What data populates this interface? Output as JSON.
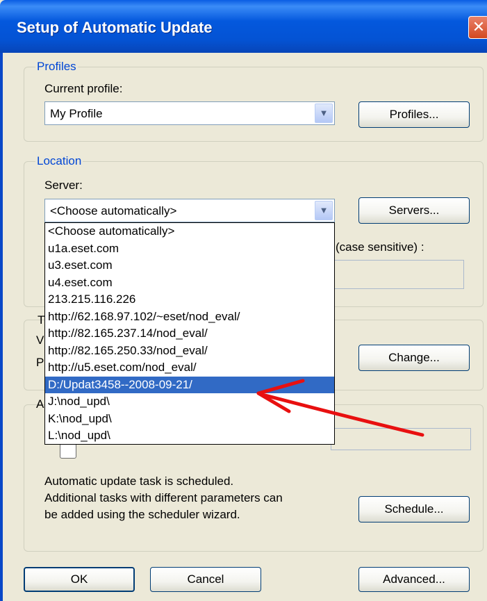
{
  "window": {
    "title": "Setup of Automatic Update",
    "close_glyph": "✕"
  },
  "profiles": {
    "legend": "Profiles",
    "current_label": "Current profile:",
    "current_value": "My Profile",
    "button": "Profiles..."
  },
  "location": {
    "legend": "Location",
    "server_label": "Server:",
    "server_value": "<Choose automatically>",
    "button": "Servers...",
    "hidden_label_tail": "(case sensitive) :"
  },
  "dropdown": {
    "items": [
      "<Choose automatically>",
      "u1a.eset.com",
      "u3.eset.com",
      "u4.eset.com",
      "213.215.116.226",
      "http://62.168.97.102/~eset/nod_eval/",
      "http://82.165.237.14/nod_eval/",
      "http://82.165.250.33/nod_eval/",
      "http://u5.eset.com/nod_eval/",
      "D:/Updat3458--2008-09-21/",
      "J:\\nod_upd\\",
      "K:\\nod_upd\\",
      "L:\\nod_upd\\"
    ],
    "selected_index": 9
  },
  "partial_letters": {
    "t": "T",
    "v": "V",
    "p": "P",
    "a": "A"
  },
  "type_group": {
    "button": "Change..."
  },
  "schedule_group": {
    "line1": "Automatic update task is scheduled.",
    "line2": "Additional tasks with different parameters can",
    "line3": "be added using the scheduler wizard.",
    "button": "Schedule..."
  },
  "footer": {
    "ok": "OK",
    "cancel": "Cancel",
    "advanced": "Advanced..."
  },
  "colors": {
    "titlebar": "#0458dd",
    "legend": "#0046d5",
    "selection": "#316ac5",
    "annotation_arrow": "#e81010"
  },
  "icons": {
    "close": "close-icon",
    "combo_arrow": "chevron-down-icon"
  }
}
